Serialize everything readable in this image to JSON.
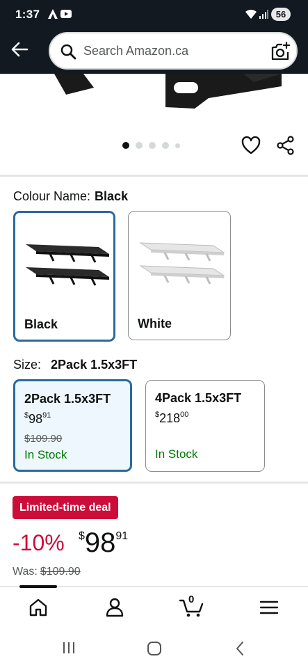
{
  "status_bar": {
    "time": "1:37",
    "battery": "56"
  },
  "search": {
    "placeholder": "Search Amazon.ca"
  },
  "gallery": {
    "image_count": 5,
    "active_index": 0
  },
  "colour": {
    "label": "Colour Name:",
    "selected": "Black",
    "options": [
      {
        "name": "Black",
        "selected": true
      },
      {
        "name": "White",
        "selected": false
      }
    ]
  },
  "size": {
    "label": "Size:",
    "selected": "2Pack 1.5x3FT",
    "options": [
      {
        "name": "2Pack 1.5x3FT",
        "currency": "$",
        "whole": "98",
        "fraction": "91",
        "was": "$109.90",
        "stock": "In Stock",
        "selected": true
      },
      {
        "name": "4Pack 1.5x3FT",
        "currency": "$",
        "whole": "218",
        "fraction": "00",
        "was": "",
        "stock": "In Stock",
        "selected": false
      }
    ]
  },
  "deal": {
    "badge": "Limited-time deal",
    "discount": "-10%",
    "currency": "$",
    "whole": "98",
    "fraction": "91",
    "was_label": "Was:",
    "was_price": "$109.90"
  },
  "bottom_nav": {
    "cart_count": "0"
  },
  "colors": {
    "brand_dark": "#131921",
    "deal_red": "#cc0c39",
    "stock_green": "#007600",
    "selected_border": "#2a6a9c"
  }
}
